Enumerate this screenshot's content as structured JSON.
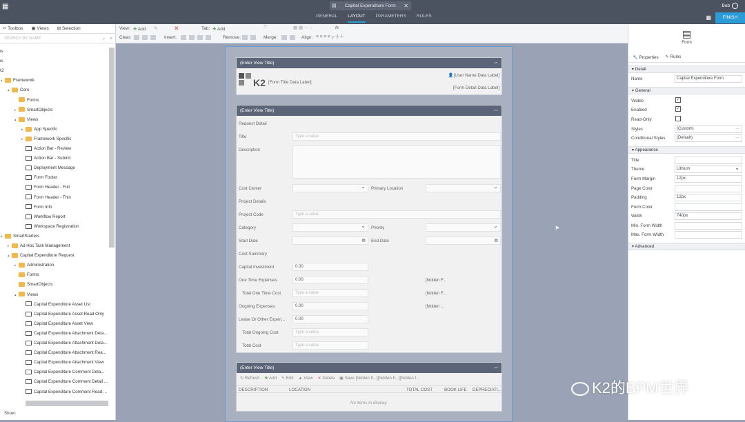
{
  "topbar": {
    "tab_title": "Capital Expenditure Form",
    "nav": [
      "GENERAL",
      "LAYOUT",
      "PARAMETERS",
      "RULES"
    ],
    "active_nav": "LAYOUT",
    "user": "Bob",
    "finish": "FINISH"
  },
  "toolbar": {
    "view_label": "View:",
    "add": "Add",
    "tab_label": "Tab:",
    "tab_add": "Add",
    "clear": "Clear:",
    "insert": "Insert:",
    "remove": "Remove:",
    "merge": "Merge:",
    "align": "Align:",
    "fx": "fx"
  },
  "left": {
    "tabs": [
      "Toolbox",
      "Views",
      "Selection"
    ],
    "search_placeholder": "SEARCH BY NAME",
    "show": "Show:",
    "tree": [
      {
        "t": "ns",
        "d": 0,
        "k": "none"
      },
      {
        "t": "os",
        "d": 0,
        "k": "none"
      },
      {
        "t": "K2",
        "d": 0,
        "k": "none"
      },
      {
        "t": "Framework",
        "d": 0,
        "k": "folder",
        "a": "▴"
      },
      {
        "t": "Core",
        "d": 1,
        "k": "folder",
        "a": "▴"
      },
      {
        "t": "Forms",
        "d": 2,
        "k": "folder"
      },
      {
        "t": "SmartObjects",
        "d": 2,
        "k": "folder",
        "a": "▸"
      },
      {
        "t": "Views",
        "d": 2,
        "k": "folder",
        "a": "▴"
      },
      {
        "t": "App Specific",
        "d": 3,
        "k": "folder",
        "a": "▸"
      },
      {
        "t": "Framework Specific",
        "d": 3,
        "k": "folder",
        "a": "▸"
      },
      {
        "t": "Action Bar - Review",
        "d": 3,
        "k": "view"
      },
      {
        "t": "Action Bar - Submit",
        "d": 3,
        "k": "view"
      },
      {
        "t": "Deployment Message",
        "d": 3,
        "k": "view"
      },
      {
        "t": "Form Footer",
        "d": 3,
        "k": "view"
      },
      {
        "t": "Form Header - Full",
        "d": 3,
        "k": "view"
      },
      {
        "t": "Form Header - Thin",
        "d": 3,
        "k": "view"
      },
      {
        "t": "Form Info",
        "d": 3,
        "k": "view"
      },
      {
        "t": "Workflow Report",
        "d": 3,
        "k": "view"
      },
      {
        "t": "Workspace Registration",
        "d": 3,
        "k": "view"
      },
      {
        "t": "SmartStarters",
        "d": 0,
        "k": "folder",
        "a": "▴"
      },
      {
        "t": "Ad Hoc Task Management",
        "d": 1,
        "k": "folder",
        "a": "▸"
      },
      {
        "t": "Capital Expenditure Request",
        "d": 1,
        "k": "folder",
        "a": "▴"
      },
      {
        "t": "Administration",
        "d": 2,
        "k": "folder",
        "a": "▸"
      },
      {
        "t": "Forms",
        "d": 2,
        "k": "folder"
      },
      {
        "t": "SmartObjects",
        "d": 2,
        "k": "folder"
      },
      {
        "t": "Views",
        "d": 2,
        "k": "folder",
        "a": "▴"
      },
      {
        "t": "Capital Expenditure Asset List",
        "d": 3,
        "k": "view"
      },
      {
        "t": "Capital Expenditure Asset Read Only",
        "d": 3,
        "k": "view"
      },
      {
        "t": "Capital Expenditure Asset View",
        "d": 3,
        "k": "view"
      },
      {
        "t": "Capital Expenditure Attachment Deta...",
        "d": 3,
        "k": "view"
      },
      {
        "t": "Capital Expenditure Attachment Deta...",
        "d": 3,
        "k": "view"
      },
      {
        "t": "Capital Expenditure Attachment Rea...",
        "d": 3,
        "k": "view"
      },
      {
        "t": "Capital Expenditure Attachment View",
        "d": 3,
        "k": "view"
      },
      {
        "t": "Capital Expenditure Comment Deta...",
        "d": 3,
        "k": "view"
      },
      {
        "t": "Capital Expenditure Comment Detail ...",
        "d": 3,
        "k": "view"
      },
      {
        "t": "Capital Expenditure Comment Read ...",
        "d": 3,
        "k": "view"
      }
    ]
  },
  "form": {
    "view_title": "(Enter View Title)",
    "header": {
      "logo": "K2",
      "title_label": "[Form Title Data Label]",
      "user_label": "[User Name Data Label]",
      "detail_label": "[Form Detail Data Label]"
    },
    "request": {
      "section1": "Request Detail",
      "title": "Title",
      "description": "Description",
      "cost_center": "Cost Center",
      "primary_location": "Primary Location",
      "section2": "Project Details",
      "project_code": "Project Code",
      "category": "Category",
      "priority": "Priority",
      "start_date": "Start Date",
      "end_date": "End Date",
      "section3": "Cost Summary",
      "capital_investment": "Capital Investment",
      "one_time": "One Time Expenses",
      "total_one_time": "Total One Time Cost",
      "ongoing": "Ongoing Expenses",
      "lease": "Lease Or Other Expen...",
      "total_ongoing": "Total Ongoing Cost",
      "total_cost": "Total Cost",
      "placeholder": "Type a value",
      "zero": "0.00",
      "hidden1": "[hidden F...",
      "hidden2": "[hidden F...",
      "hidden3": "[hidden ..."
    },
    "list": {
      "refresh": "Refresh",
      "add": "Add",
      "edit": "Edit",
      "view": "View",
      "delete": "Delete",
      "save": "Save",
      "hidden": "[hidden fi...][hidden fi...][hidden f...",
      "cols": [
        "DESCRIPTION",
        "LOCATION",
        "TOTAL COST",
        "BOOK LIFE",
        "DEPRECIATI..."
      ],
      "empty": "No items to display."
    }
  },
  "right": {
    "form_label": "Form",
    "tabs": [
      "Properties",
      "Rules"
    ],
    "detail": "Detail",
    "name_label": "Name",
    "name_value": "Capital Expenditure Form",
    "general": "General",
    "visible": "Visible",
    "enabled": "Enabled",
    "readonly": "Read-Only",
    "styles": "Styles",
    "styles_value": "(Custom)",
    "cond_styles": "Conditional Styles",
    "cond_value": "(Default)",
    "appearance": "Appearance",
    "title": "Title",
    "theme": "Theme",
    "theme_value": "Lithium",
    "form_margin": "Form Margin",
    "form_margin_value": "12px",
    "page_color": "Page Color",
    "padding": "Padding",
    "padding_value": "12px",
    "form_color": "Form Color",
    "width": "Width",
    "width_value": "740px",
    "min_width": "Min. Form Width",
    "max_width": "Max. Form Width",
    "advanced": "Advanced"
  },
  "watermark": "K2的BPM世界"
}
